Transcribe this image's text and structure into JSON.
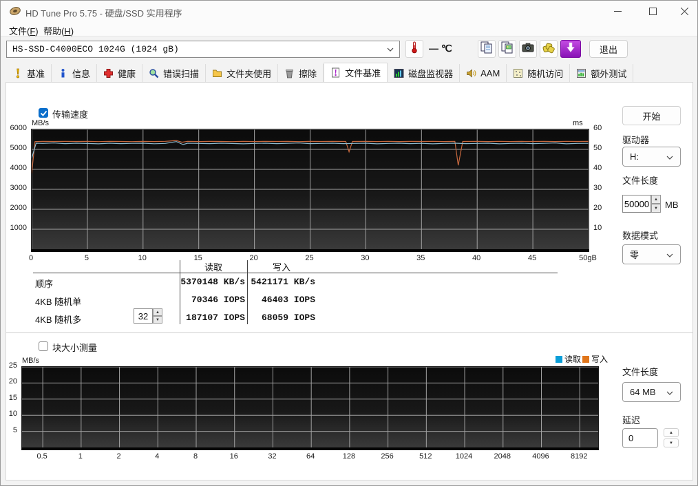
{
  "window": {
    "title": "HD Tune Pro 5.75 - 硬盘/SSD 实用程序"
  },
  "menu": {
    "file": {
      "pre": "文件(",
      "key": "F",
      "post": ")"
    },
    "help": {
      "pre": "帮助(",
      "key": "H",
      "post": ")"
    }
  },
  "toolbar": {
    "drive_selector": "HS-SSD-C4000ECO 1024G (1024 gB)",
    "temperature": "— ℃",
    "exit_label": "退出",
    "icons": [
      "thermometer-icon",
      "copy-text-icon",
      "copy-image-icon",
      "camera-icon",
      "export-icon",
      "save-results-icon"
    ]
  },
  "tabs": {
    "selected": "文件基准",
    "items": [
      {
        "label": "基准",
        "icon": "benchmark-icon"
      },
      {
        "label": "信息",
        "icon": "info-icon"
      },
      {
        "label": "健康",
        "icon": "health-icon"
      },
      {
        "label": "错误扫描",
        "icon": "error-scan-icon"
      },
      {
        "label": "文件夹使用",
        "icon": "folder-usage-icon"
      },
      {
        "label": "擦除",
        "icon": "erase-icon"
      },
      {
        "label": "文件基准",
        "icon": "file-benchmark-icon"
      },
      {
        "label": "磁盘监视器",
        "icon": "disk-monitor-icon"
      },
      {
        "label": "AAM",
        "icon": "aam-icon"
      },
      {
        "label": "随机访问",
        "icon": "random-access-icon"
      },
      {
        "label": "额外测试",
        "icon": "extra-tests-icon"
      }
    ]
  },
  "file_benchmark": {
    "transfer_speed": {
      "label": "传输速度",
      "checked": true
    },
    "results": {
      "col_read": "读取",
      "col_write": "写入",
      "queue_depth": "32",
      "rows": [
        {
          "label": "顺序",
          "read": "5370148 KB/s",
          "write": "5421171 KB/s"
        },
        {
          "label": "4KB 随机单",
          "read": "70346 IOPS",
          "write": "46403 IOPS"
        },
        {
          "label": "4KB 随机多",
          "read": "187107 IOPS",
          "write": "68059 IOPS"
        }
      ]
    },
    "block_test": {
      "label": "块大小测量",
      "checked": false
    }
  },
  "side_panel": {
    "start_button": "开始",
    "drive_label": "驱动器",
    "drive_value": "H:",
    "file_length_label": "文件长度",
    "file_length_value": "50000",
    "file_length_unit": "MB",
    "data_mode_label": "数据模式",
    "data_mode_value": "零",
    "block_file_length_label": "文件长度",
    "block_file_length_value": "64 MB",
    "delay_label": "延迟",
    "delay_value": "0"
  },
  "chart_data": [
    {
      "type": "line",
      "title": "传输速度",
      "ylabel_left": "MB/s",
      "ylabel_right": "ms",
      "xlim": [
        0,
        50
      ],
      "ylim_left": [
        0,
        6000
      ],
      "ylim_right": [
        0,
        60
      ],
      "grid": true,
      "x_ticks": [
        "0",
        "5",
        "10",
        "15",
        "20",
        "25",
        "30",
        "35",
        "40",
        "45",
        "50gB"
      ],
      "y_ticks_left": [
        "6000",
        "5000",
        "4000",
        "3000",
        "2000",
        "1000"
      ],
      "y_ticks_right": [
        "60",
        "50",
        "40",
        "30",
        "20",
        "10"
      ],
      "series": [
        {
          "name": "写入",
          "color": "#c8693f",
          "points": [
            [
              0,
              3800
            ],
            [
              0.3,
              5390
            ],
            [
              1,
              5400
            ],
            [
              2,
              5395
            ],
            [
              3,
              5405
            ],
            [
              4,
              5395
            ],
            [
              5,
              5400
            ],
            [
              6,
              5390
            ],
            [
              7,
              5402
            ],
            [
              8,
              5396
            ],
            [
              9,
              5388
            ],
            [
              10,
              5400
            ],
            [
              11,
              5394
            ],
            [
              12,
              5402
            ],
            [
              13,
              5440
            ],
            [
              13.5,
              5360
            ],
            [
              14,
              5405
            ],
            [
              15,
              5392
            ],
            [
              16,
              5400
            ],
            [
              17,
              5396
            ],
            [
              18,
              5388
            ],
            [
              19,
              5400
            ],
            [
              20,
              5392
            ],
            [
              21,
              5402
            ],
            [
              22,
              5396
            ],
            [
              23,
              5400
            ],
            [
              24,
              5390
            ],
            [
              25,
              5400
            ],
            [
              26,
              5396
            ],
            [
              27,
              5402
            ],
            [
              28.2,
              5398
            ],
            [
              28.5,
              4880
            ],
            [
              28.8,
              5395
            ],
            [
              30,
              5400
            ],
            [
              31,
              5394
            ],
            [
              32,
              5402
            ],
            [
              33,
              5392
            ],
            [
              34,
              5400
            ],
            [
              35,
              5396
            ],
            [
              36,
              5402
            ],
            [
              37,
              5392
            ],
            [
              38,
              5400
            ],
            [
              38.3,
              4200
            ],
            [
              38.7,
              5395
            ],
            [
              40,
              5400
            ],
            [
              41,
              5394
            ],
            [
              42,
              5402
            ],
            [
              43,
              5392
            ],
            [
              44,
              5400
            ],
            [
              45,
              5396
            ],
            [
              46,
              5402
            ],
            [
              47,
              5392
            ],
            [
              48,
              5400
            ],
            [
              49,
              5396
            ],
            [
              50,
              5400
            ]
          ]
        },
        {
          "name": "读取",
          "color": "#8cb9cd",
          "points": [
            [
              0,
              4550
            ],
            [
              0.4,
              5310
            ],
            [
              1,
              5300
            ],
            [
              2,
              5322
            ],
            [
              3,
              5288
            ],
            [
              4,
              5310
            ],
            [
              5,
              5298
            ],
            [
              6,
              5280
            ],
            [
              7,
              5312
            ],
            [
              8,
              5290
            ],
            [
              9,
              5302
            ],
            [
              10,
              5312
            ],
            [
              11,
              5282
            ],
            [
              12,
              5300
            ],
            [
              13,
              5390
            ],
            [
              13.6,
              5240
            ],
            [
              14,
              5310
            ],
            [
              15,
              5300
            ],
            [
              16,
              5288
            ],
            [
              17,
              5312
            ],
            [
              18,
              5298
            ],
            [
              19,
              5280
            ],
            [
              20,
              5300
            ],
            [
              21,
              5312
            ],
            [
              22,
              5288
            ],
            [
              23,
              5302
            ],
            [
              24,
              5322
            ],
            [
              25,
              5290
            ],
            [
              26,
              5300
            ],
            [
              27,
              5312
            ],
            [
              28,
              5288
            ],
            [
              29,
              5300
            ],
            [
              30,
              5312
            ],
            [
              31,
              5280
            ],
            [
              32,
              5300
            ],
            [
              33,
              5312
            ],
            [
              34,
              5288
            ],
            [
              35,
              5302
            ],
            [
              36,
              5280
            ],
            [
              37,
              5300
            ],
            [
              38,
              5312
            ],
            [
              39,
              5288
            ],
            [
              40,
              5300
            ],
            [
              41,
              5312
            ],
            [
              42,
              5280
            ],
            [
              43,
              5300
            ],
            [
              44,
              5312
            ],
            [
              45,
              5288
            ],
            [
              46,
              5302
            ],
            [
              47,
              5322
            ],
            [
              48,
              5280
            ],
            [
              49,
              5300
            ],
            [
              50,
              5302
            ]
          ]
        }
      ]
    },
    {
      "type": "line",
      "title": "块大小测量",
      "ylabel_left": "MB/s",
      "ylim_left": [
        0,
        25
      ],
      "grid": true,
      "x_ticks": [
        "0.5",
        "1",
        "2",
        "4",
        "8",
        "16",
        "32",
        "64",
        "128",
        "256",
        "512",
        "1024",
        "2048",
        "4096",
        "8192"
      ],
      "y_ticks_left": [
        "25",
        "20",
        "15",
        "10",
        "5"
      ],
      "legend": [
        {
          "label": "读取",
          "color": "#0a9ed8"
        },
        {
          "label": "写入",
          "color": "#e0761c"
        }
      ],
      "series": []
    }
  ]
}
